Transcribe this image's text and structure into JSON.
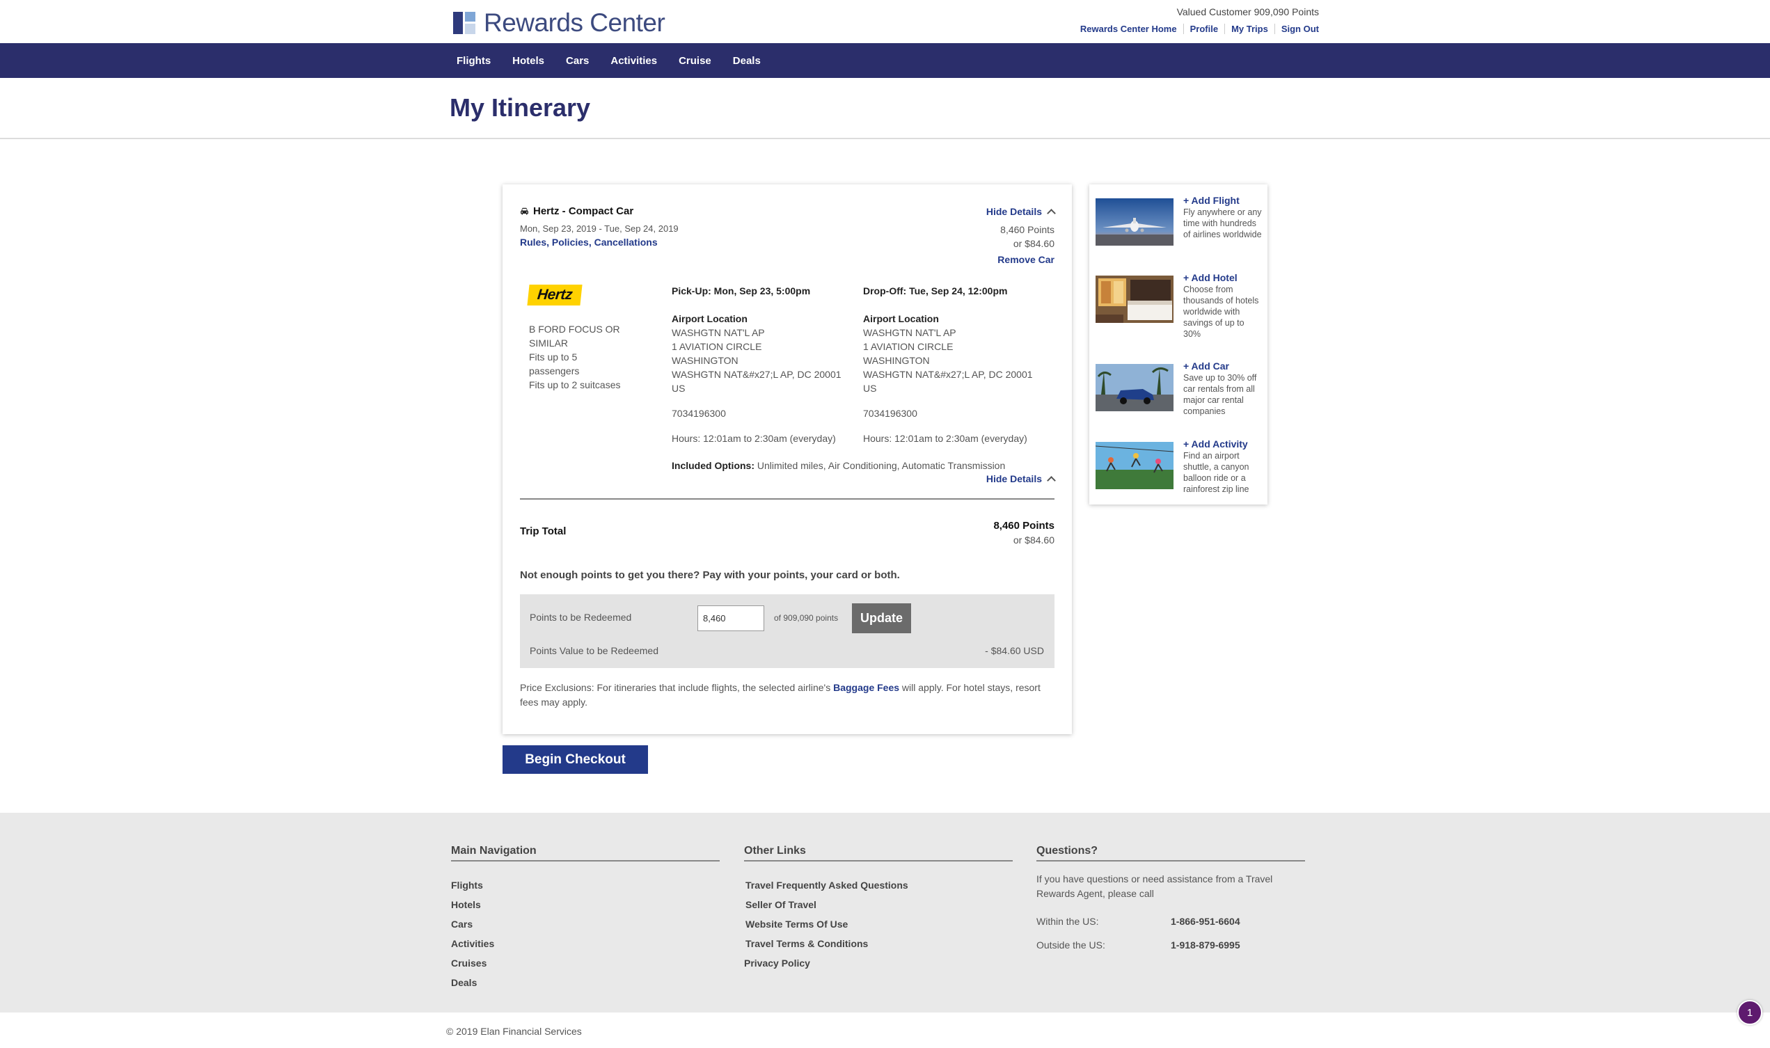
{
  "header": {
    "brand": "Rewards Center",
    "customer": "Valued Customer 909,090 Points",
    "links": [
      "Rewards Center Home",
      "Profile",
      "My Trips",
      "Sign Out"
    ]
  },
  "nav": [
    "Flights",
    "Hotels",
    "Cars",
    "Activities",
    "Cruise",
    "Deals"
  ],
  "page_title": "My Itinerary",
  "booking": {
    "title": "Hertz - Compact Car",
    "dates": "Mon, Sep 23, 2019 - Tue, Sep 24, 2019",
    "rules_link": "Rules, Policies, Cancellations",
    "hide_details": "Hide Details",
    "points": "8,460 Points",
    "usd": "or $84.60",
    "remove": "Remove Car",
    "vendor_logo_text": "Hertz",
    "vehicle": [
      "B FORD FOCUS OR SIMILAR",
      "Fits up to 5 passengers",
      "Fits up to 2 suitcases"
    ],
    "pickup": {
      "heading": "Pick-Up: Mon, Sep 23, 5:00pm",
      "location_label": "Airport Location",
      "address": [
        "WASHGTN NAT'L AP",
        "1 AVIATION CIRCLE",
        "WASHINGTON",
        "WASHGTN NAT&#x27;L AP, DC 20001",
        "US"
      ],
      "phone": "7034196300",
      "hours": "Hours: 12:01am to 2:30am (everyday)"
    },
    "dropoff": {
      "heading": "Drop-Off: Tue, Sep 24, 12:00pm",
      "location_label": "Airport Location",
      "address": [
        "WASHGTN NAT'L AP",
        "1 AVIATION CIRCLE",
        "WASHINGTON",
        "WASHGTN NAT&#x27;L AP, DC 20001",
        "US"
      ],
      "phone": "7034196300",
      "hours": "Hours: 12:01am to 2:30am (everyday)"
    },
    "included_label": "Included Options:",
    "included_value": " Unlimited miles, Air Conditioning, Automatic Transmission"
  },
  "trip_total": {
    "label": "Trip Total",
    "points": "8,460 Points",
    "usd": "or $84.60"
  },
  "payment": {
    "prompt": "Not enough points to get you there? Pay with your points, your card or both.",
    "points_label": "Points to be Redeemed",
    "points_value": "8,460",
    "of_points": "of 909,090 points",
    "update": "Update",
    "value_label": "Points Value to be Redeemed",
    "value_amount": "- $84.60 USD"
  },
  "exclusions": {
    "before": "Price Exclusions: For itineraries that include flights, the selected airline's ",
    "link": "Baggage Fees",
    "after": " will apply. For hotel stays, resort fees may apply."
  },
  "checkout": "Begin Checkout",
  "side": [
    {
      "link": "+ Add Flight",
      "text": "Fly anywhere or any time with hundreds of airlines worldwide"
    },
    {
      "link": "+ Add Hotel",
      "text": "Choose from thousands of hotels worldwide with savings of up to 30%"
    },
    {
      "link": "+ Add Car",
      "text": "Save up to 30% off car rentals from all major car rental companies"
    },
    {
      "link": "+ Add Activity",
      "text": "Find an airport shuttle, a canyon balloon ride or a rainforest zip line"
    }
  ],
  "footer": {
    "main_nav_title": "Main Navigation",
    "main_nav": [
      "Flights",
      "Hotels",
      "Cars",
      "Activities",
      "Cruises",
      "Deals"
    ],
    "other_title": "Other Links",
    "other": [
      "Travel Frequently Asked Questions",
      "Seller Of Travel",
      "Website Terms Of Use",
      "Travel Terms & Conditions",
      "Privacy Policy"
    ],
    "questions_title": "Questions?",
    "questions_text": "If you have questions or need assistance from a Travel Rewards Agent, please call",
    "within_label": "Within the US:",
    "within_number": "1-866-951-6604",
    "outside_label": "Outside the US:",
    "outside_number": "1-918-879-6995"
  },
  "copyright": "© 2019 Elan Financial Services",
  "chat_badge": "1"
}
